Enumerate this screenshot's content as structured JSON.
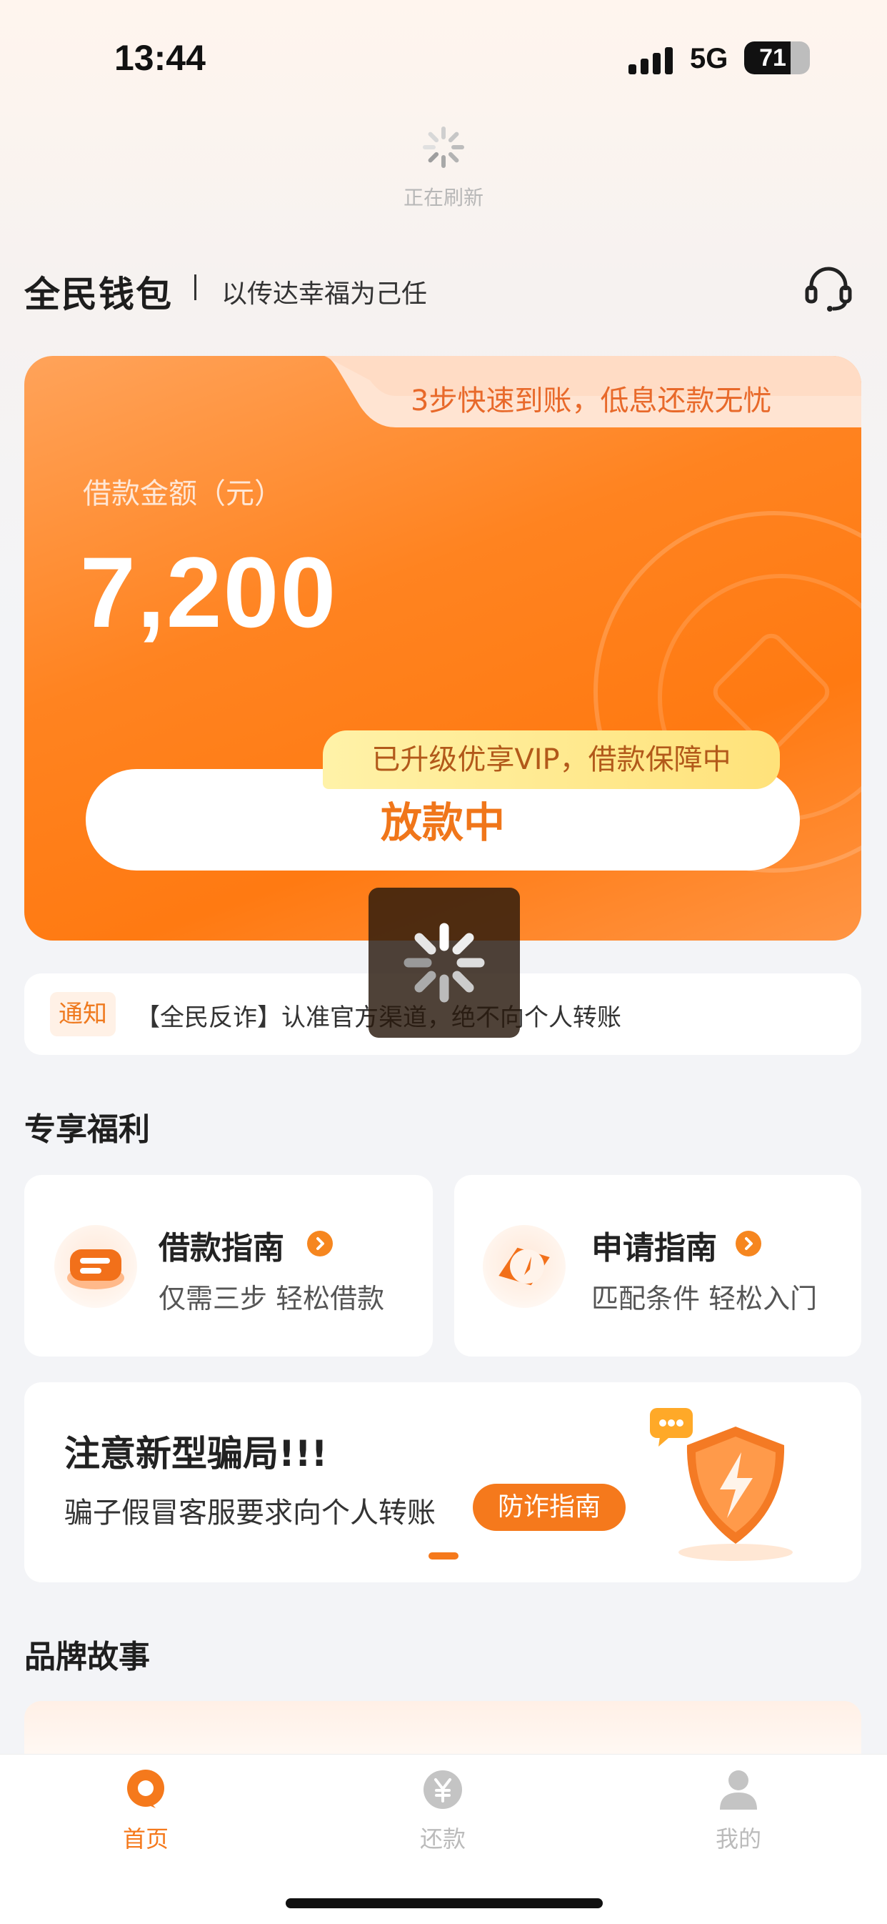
{
  "status_bar": {
    "time": "13:44",
    "network": "5G",
    "battery": "71",
    "battery_level": 0.71
  },
  "refresh": {
    "text": "正在刷新"
  },
  "header": {
    "brand": "全民钱包",
    "slogan": "以传达幸福为己任",
    "icon": "headset-icon"
  },
  "loan_card": {
    "promo": "3步快速到账，低息还款无忧",
    "amount_label": "借款金额（元）",
    "amount": "7,200",
    "vip_tag": "已升级优享VIP，借款保障中",
    "button_label": "放款中"
  },
  "notice": {
    "tag": "通知",
    "text": "【全民反诈】认准官方渠道，绝不向个人转账"
  },
  "benefits": {
    "title": "专享福利",
    "items": [
      {
        "title": "借款指南",
        "subtitle": "仅需三步 轻松借款",
        "icon": "loan-guide-icon"
      },
      {
        "title": "申请指南",
        "subtitle": "匹配条件 轻松入门",
        "icon": "compass-icon"
      }
    ]
  },
  "fraud": {
    "title": "注意新型骗局!!!",
    "subtitle": "骗子假冒客服要求向个人转账",
    "button": "防诈指南",
    "icon": "shield-lightning-icon"
  },
  "brand_story": {
    "title": "品牌故事"
  },
  "tabbar": {
    "items": [
      {
        "label": "首页",
        "icon": "home-icon",
        "active": true
      },
      {
        "label": "还款",
        "icon": "yuan-icon",
        "active": false
      },
      {
        "label": "我的",
        "icon": "profile-icon",
        "active": false
      }
    ]
  },
  "colors": {
    "accent": "#F5791C",
    "card": "#FF8320",
    "text": "#222222",
    "inactive": "#BBBBBB"
  }
}
